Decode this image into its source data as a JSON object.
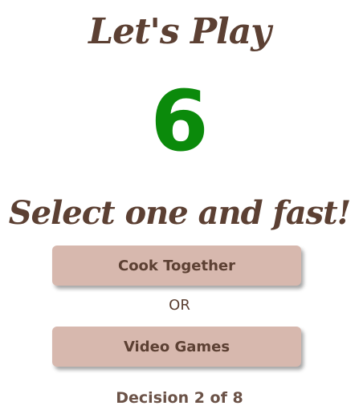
{
  "game": {
    "title": "Let's Play",
    "countdown": "6",
    "prompt": "Select one and fast!",
    "option_a": "Cook Together",
    "separator": "OR",
    "option_b": "Video Games",
    "progress_text": "Decision 2 of 8",
    "decision_current": 2,
    "decision_total": 8
  },
  "colors": {
    "heading": "#5c4033",
    "countdown": "#0b8a0b",
    "button_bg": "#d7b8ae",
    "button_text": "#5c4033",
    "background": "#ffffff"
  }
}
